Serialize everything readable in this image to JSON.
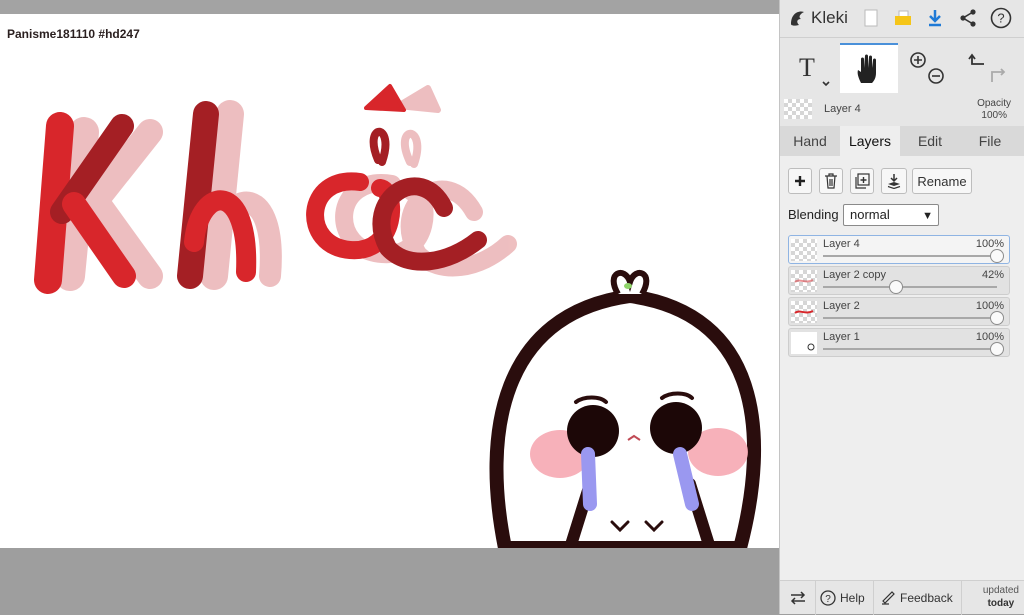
{
  "canvas": {
    "watermark": "Panisme181110 #hd247",
    "artwork_text": "Khóc"
  },
  "app": {
    "logo": "Kleki"
  },
  "current_layer": {
    "name": "Layer 4",
    "opacity_label": "Opacity",
    "opacity_value": "100%"
  },
  "tabs": [
    {
      "label": "Hand",
      "active": false
    },
    {
      "label": "Layers",
      "active": true
    },
    {
      "label": "Edit",
      "active": false
    },
    {
      "label": "File",
      "active": false
    }
  ],
  "layer_actions": {
    "rename_label": "Rename"
  },
  "blending": {
    "label": "Blending",
    "value": "normal"
  },
  "layers": [
    {
      "name": "Layer 4",
      "opacity": "100%",
      "opacity_value": 1.0,
      "selected": true
    },
    {
      "name": "Layer 2 copy",
      "opacity": "42%",
      "opacity_value": 0.42,
      "selected": false
    },
    {
      "name": "Layer 2",
      "opacity": "100%",
      "opacity_value": 1.0,
      "selected": false
    },
    {
      "name": "Layer 1",
      "opacity": "100%",
      "opacity_value": 1.0,
      "selected": false
    }
  ],
  "bottom": {
    "help_label": "Help",
    "feedback_label": "Feedback",
    "updated_line1": "updated",
    "updated_line2": "today"
  },
  "colors": {
    "accent_blue": "#1f7ad6",
    "art_red": "#d8262b",
    "art_dark_red": "#9e1d22",
    "art_pink": "#e8a2a4"
  }
}
